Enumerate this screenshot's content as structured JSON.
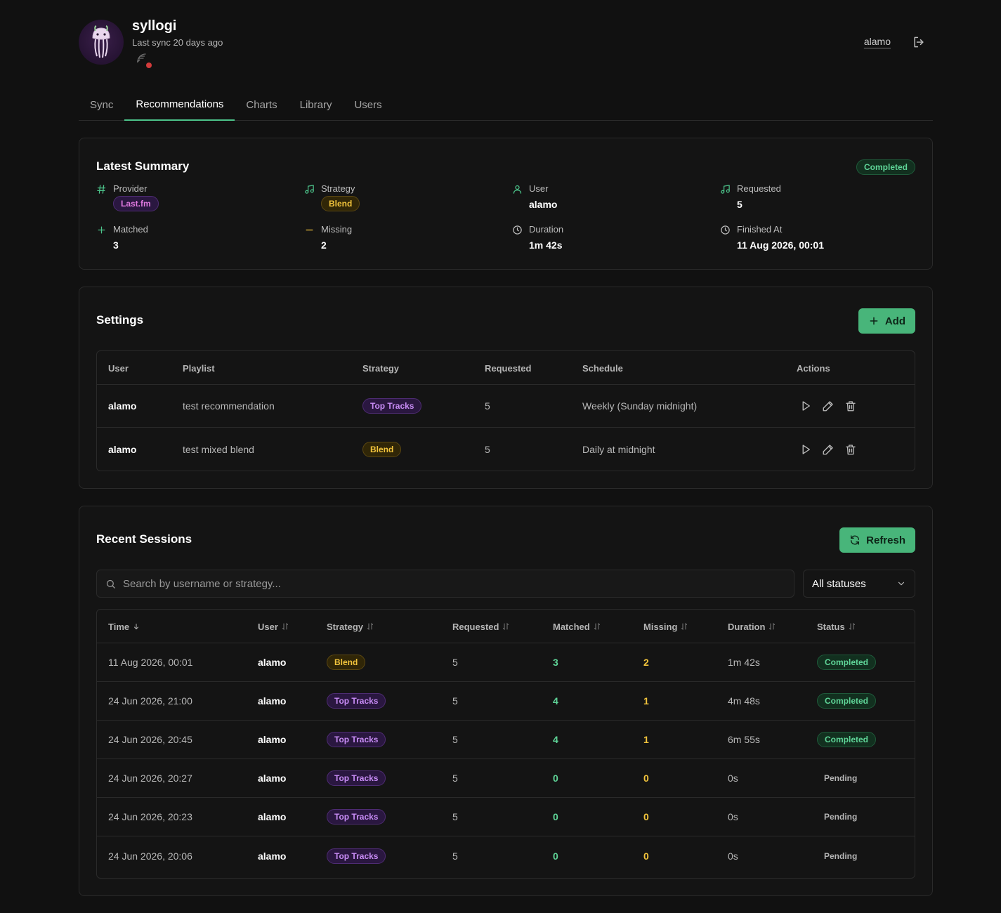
{
  "header": {
    "app_name": "syllogi",
    "last_sync": "Last sync 20 days ago",
    "username": "alamo",
    "status_dot_color": "#d23b3b"
  },
  "tabs": [
    {
      "label": "Sync",
      "active": false
    },
    {
      "label": "Recommendations",
      "active": true
    },
    {
      "label": "Charts",
      "active": false
    },
    {
      "label": "Library",
      "active": false
    },
    {
      "label": "Users",
      "active": false
    }
  ],
  "summary": {
    "title": "Latest Summary",
    "status": "Completed",
    "fields": {
      "provider": {
        "label": "Provider",
        "value": "Last.fm"
      },
      "strategy": {
        "label": "Strategy",
        "value": "Blend"
      },
      "user": {
        "label": "User",
        "value": "alamo"
      },
      "requested": {
        "label": "Requested",
        "value": "5"
      },
      "matched": {
        "label": "Matched",
        "value": "3"
      },
      "missing": {
        "label": "Missing",
        "value": "2"
      },
      "duration": {
        "label": "Duration",
        "value": "1m 42s"
      },
      "finished_at": {
        "label": "Finished At",
        "value": "11 Aug 2026, 00:01"
      }
    }
  },
  "settings": {
    "title": "Settings",
    "add_label": "Add",
    "columns": [
      "User",
      "Playlist",
      "Strategy",
      "Requested",
      "Schedule",
      "Actions"
    ],
    "rows": [
      {
        "user": "alamo",
        "playlist": "test recommendation",
        "strategy": "Top Tracks",
        "requested": "5",
        "schedule": "Weekly (Sunday midnight)"
      },
      {
        "user": "alamo",
        "playlist": "test mixed blend",
        "strategy": "Blend",
        "requested": "5",
        "schedule": "Daily at midnight"
      }
    ]
  },
  "sessions": {
    "title": "Recent Sessions",
    "refresh_label": "Refresh",
    "search_placeholder": "Search by username or strategy...",
    "status_filter": "All statuses",
    "columns": [
      "Time",
      "User",
      "Strategy",
      "Requested",
      "Matched",
      "Missing",
      "Duration",
      "Status"
    ],
    "rows": [
      {
        "time": "11 Aug 2026, 00:01",
        "user": "alamo",
        "strategy": "Blend",
        "requested": "5",
        "matched": "3",
        "missing": "2",
        "duration": "1m 42s",
        "status": "Completed"
      },
      {
        "time": "24 Jun 2026, 21:00",
        "user": "alamo",
        "strategy": "Top Tracks",
        "requested": "5",
        "matched": "4",
        "missing": "1",
        "duration": "4m 48s",
        "status": "Completed"
      },
      {
        "time": "24 Jun 2026, 20:45",
        "user": "alamo",
        "strategy": "Top Tracks",
        "requested": "5",
        "matched": "4",
        "missing": "1",
        "duration": "6m 55s",
        "status": "Completed"
      },
      {
        "time": "24 Jun 2026, 20:27",
        "user": "alamo",
        "strategy": "Top Tracks",
        "requested": "5",
        "matched": "0",
        "missing": "0",
        "duration": "0s",
        "status": "Pending"
      },
      {
        "time": "24 Jun 2026, 20:23",
        "user": "alamo",
        "strategy": "Top Tracks",
        "requested": "5",
        "matched": "0",
        "missing": "0",
        "duration": "0s",
        "status": "Pending"
      },
      {
        "time": "24 Jun 2026, 20:06",
        "user": "alamo",
        "strategy": "Top Tracks",
        "requested": "5",
        "matched": "0",
        "missing": "0",
        "duration": "0s",
        "status": "Pending"
      }
    ]
  },
  "colors": {
    "accent": "#48b57a",
    "completed": "#5fd598",
    "top_tracks": "#c88cf5",
    "blend": "#f2c43c",
    "lastfm": "#e07ae0"
  }
}
